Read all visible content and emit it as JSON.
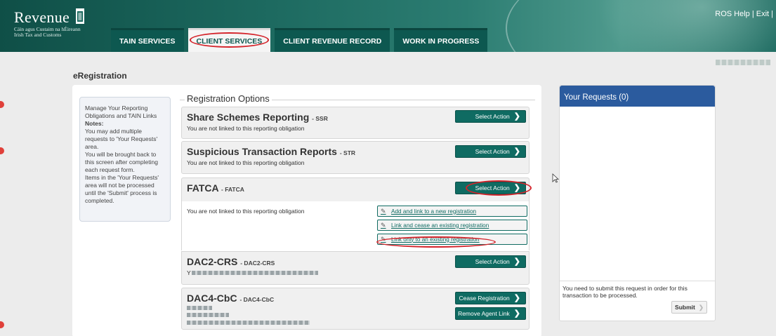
{
  "header": {
    "logo_word": "Revenue",
    "logo_sub1": "Cáin agus Custaim na hÉireann",
    "logo_sub2": "Irish Tax and Customs",
    "top_links": "ROS Help | Exit |"
  },
  "tabs": [
    {
      "label": "TAIN SERVICES",
      "active": false
    },
    {
      "label": "CLIENT SERVICES",
      "active": true
    },
    {
      "label": "CLIENT REVENUE RECORD",
      "active": false
    },
    {
      "label": "WORK IN PROGRESS",
      "active": false
    }
  ],
  "page": {
    "title": "eRegistration"
  },
  "info": {
    "line1": "Manage Your Reporting Obligations and TAIN Links",
    "notes_label": "Notes:",
    "line2": "You may add multiple requests to 'Your Requests' area.",
    "line3": "You will be brought back to this screen after completing each request form.",
    "line4": "Items in the 'Your Requests' area will not be processed until the 'Submit' process is completed."
  },
  "registration": {
    "legend": "Registration Options",
    "ssr": {
      "title": "Share Schemes Reporting",
      "code": "- SSR",
      "desc": "You are not linked to this reporting obligation",
      "button": "Select Action"
    },
    "str": {
      "title": "Suspicious Transaction Reports",
      "code": "- STR",
      "desc": "You are not linked to this reporting obligation",
      "button": "Select Action"
    },
    "fatca": {
      "title": "FATCA",
      "code": "- FATCA",
      "button": "Select Action",
      "desc": "You are not linked to this reporting obligation",
      "sub_actions": [
        "Add and link to a new registration",
        "Link and cease an existing registration",
        "Link only to an existing registration"
      ]
    },
    "dac2": {
      "title": "DAC2-CRS",
      "code": "- DAC2-CRS",
      "desc_prefix": "Y",
      "button": "Select Action"
    },
    "dac4": {
      "title": "DAC4-CbC",
      "code": "- DAC4-CbC",
      "button_cease": "Cease Registration",
      "button_remove": "Remove Agent Link"
    }
  },
  "requests": {
    "title": "Your Requests (0)",
    "note": "You need to submit this request in order for this transaction to be processed.",
    "submit": "Submit"
  },
  "colors": {
    "brand_green": "#0f6b62",
    "requests_blue": "#2b5b9e",
    "highlight_red": "#d4232a"
  }
}
